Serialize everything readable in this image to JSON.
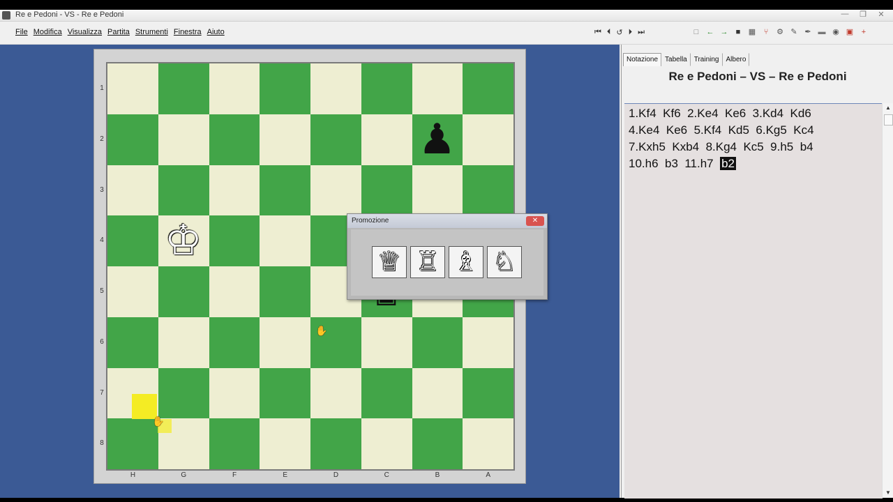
{
  "window": {
    "title": "Re e Pedoni - VS - Re e Pedoni",
    "controls": [
      "—",
      "❐",
      "✕"
    ]
  },
  "menu": [
    "File",
    "Modifica",
    "Visualizza",
    "Partita",
    "Strumenti",
    "Finestra",
    "Aiuto"
  ],
  "nav_buttons": [
    "⏮",
    "⏴",
    "↺",
    "⏵",
    "⏭"
  ],
  "toolbar_icons": [
    {
      "name": "new-icon",
      "glyph": "□",
      "color": "#777777"
    },
    {
      "name": "arrow-left-icon",
      "glyph": "←",
      "color": "#2a8a2a"
    },
    {
      "name": "arrow-right-icon",
      "glyph": "→",
      "color": "#2a8a2a"
    },
    {
      "name": "save-icon",
      "glyph": "■",
      "color": "#333333"
    },
    {
      "name": "board-icon",
      "glyph": "▦",
      "color": "#555555"
    },
    {
      "name": "tree-icon",
      "glyph": "⑂",
      "color": "#c0392b"
    },
    {
      "name": "engine-icon",
      "glyph": "⚙",
      "color": "#555555"
    },
    {
      "name": "edit-icon",
      "glyph": "✎",
      "color": "#555555"
    },
    {
      "name": "pen-icon",
      "glyph": "✒",
      "color": "#555555"
    },
    {
      "name": "eraser-icon",
      "glyph": "▬",
      "color": "#777777"
    },
    {
      "name": "eye-icon",
      "glyph": "◉",
      "color": "#555555"
    },
    {
      "name": "grid-icon",
      "glyph": "▣",
      "color": "#c0392b"
    },
    {
      "name": "plus-icon",
      "glyph": "+",
      "color": "#c0392b"
    }
  ],
  "board": {
    "ranks": [
      "1",
      "2",
      "3",
      "4",
      "5",
      "6",
      "7",
      "8"
    ],
    "files": [
      "H",
      "G",
      "F",
      "E",
      "D",
      "C",
      "B",
      "A"
    ],
    "colors": {
      "light": "#eeeed2",
      "dark": "#42a548",
      "highlight": "#f4ec24"
    },
    "pieces": [
      {
        "name": "black-pawn",
        "glyph": "♟",
        "color": "black",
        "square": "b2"
      },
      {
        "name": "white-king",
        "glyph": "♔",
        "color": "white",
        "square": "g4"
      },
      {
        "name": "black-king",
        "glyph": "♚",
        "color": "black",
        "square": "c5"
      }
    ]
  },
  "promotion": {
    "title": "Promozione",
    "close": "✕",
    "options": [
      {
        "name": "queen",
        "glyph": "♕"
      },
      {
        "name": "rook",
        "glyph": "♖"
      },
      {
        "name": "bishop",
        "glyph": "♗"
      },
      {
        "name": "knight",
        "glyph": "♘"
      }
    ]
  },
  "panel": {
    "tabs": [
      "Notazione",
      "Tabella",
      "Training",
      "Albero"
    ],
    "active_tab": 0,
    "game_title": "Re e Pedoni  –  VS  –  Re e Pedoni",
    "moves": [
      "1.Kf4  Kf6  2.Ke4  Ke6  3.Kd4  Kd6",
      "4.Ke4  Ke6  5.Kf4  Kd5  6.Kg5  Kc4",
      "7.Kxh5  Kxb4  8.Kg4  Kc5  9.h5  b4",
      "10.h6  b3  11.h7  "
    ],
    "current_move": "b2"
  }
}
